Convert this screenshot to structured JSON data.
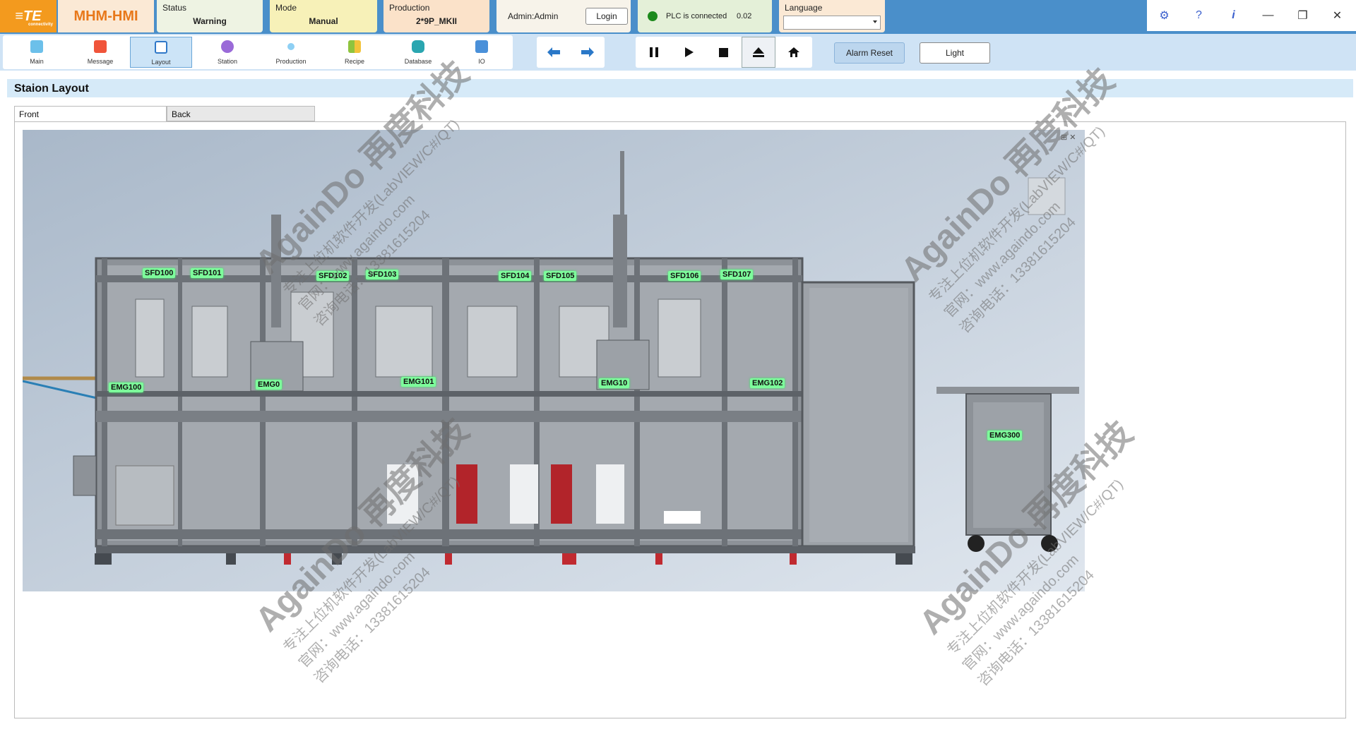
{
  "header": {
    "logo_text": "≡TE",
    "logo_sub": "connectivity",
    "app_title": "MHM-HMI",
    "status": {
      "caption": "Status",
      "value": "Warning"
    },
    "mode": {
      "caption": "Mode",
      "value": "Manual"
    },
    "production": {
      "caption": "Production",
      "value": "2*9P_MKII"
    },
    "admin": {
      "user": "Admin:Admin",
      "login_label": "Login"
    },
    "plc": {
      "text": "PLC is connected",
      "value": "0.02",
      "status_color": "#1c8a1c"
    },
    "language": {
      "caption": "Language",
      "value": ""
    }
  },
  "window_controls": {
    "settings": "⚙",
    "help": "?",
    "info": "i",
    "minimize": "—",
    "restore": "❐",
    "close": "✕"
  },
  "nav": {
    "items": [
      {
        "label": "Main",
        "icon": "home-icon",
        "color": "#6cc0ea"
      },
      {
        "label": "Message",
        "icon": "message-icon",
        "color": "#f0543a"
      },
      {
        "label": "Layout",
        "icon": "layout-icon",
        "color": "#2f78c8"
      },
      {
        "label": "Station",
        "icon": "station-icon",
        "color": "#9a6ad8"
      },
      {
        "label": "Production",
        "icon": "production-icon",
        "color": "#8ed0f4"
      },
      {
        "label": "Recipe",
        "icon": "recipe-icon",
        "color": "#8fc43e"
      },
      {
        "label": "Database",
        "icon": "database-icon",
        "color": "#2aa6b0"
      },
      {
        "label": "IO",
        "icon": "io-icon",
        "color": "#4a90d9"
      }
    ],
    "active": "Layout"
  },
  "toolbar": {
    "alarm_reset_label": "Alarm Reset",
    "light_label": "Light"
  },
  "page": {
    "title": "Staion Layout",
    "tabs": [
      {
        "label": "Front",
        "active": true
      },
      {
        "label": "Back",
        "active": false
      }
    ]
  },
  "stations": {
    "sfd100": "SFD100",
    "sfd101": "SFD101",
    "sfd102": "SFD102",
    "sfd103": "SFD103",
    "sfd104": "SFD104",
    "sfd105": "SFD105",
    "sfd106": "SFD106",
    "sfd107": "SFD107",
    "emg100": "EMG100",
    "emg0": "EMG0",
    "emg101": "EMG101",
    "emg10": "EMG10",
    "emg102": "EMG102",
    "emg300": "EMG300"
  },
  "watermark": {
    "brand": "AgainDo 再度科技",
    "line1": "专注上位机软件开发(LabVIEW/C#/QT)",
    "line2": "官网：www.againdo.com",
    "line3": "咨询电话：13381615204"
  },
  "colors": {
    "accent": "#4a8fca",
    "toolbar": "#cfe3f5",
    "label_green": "#7dfc9b",
    "logo_orange": "#f39a1e"
  }
}
